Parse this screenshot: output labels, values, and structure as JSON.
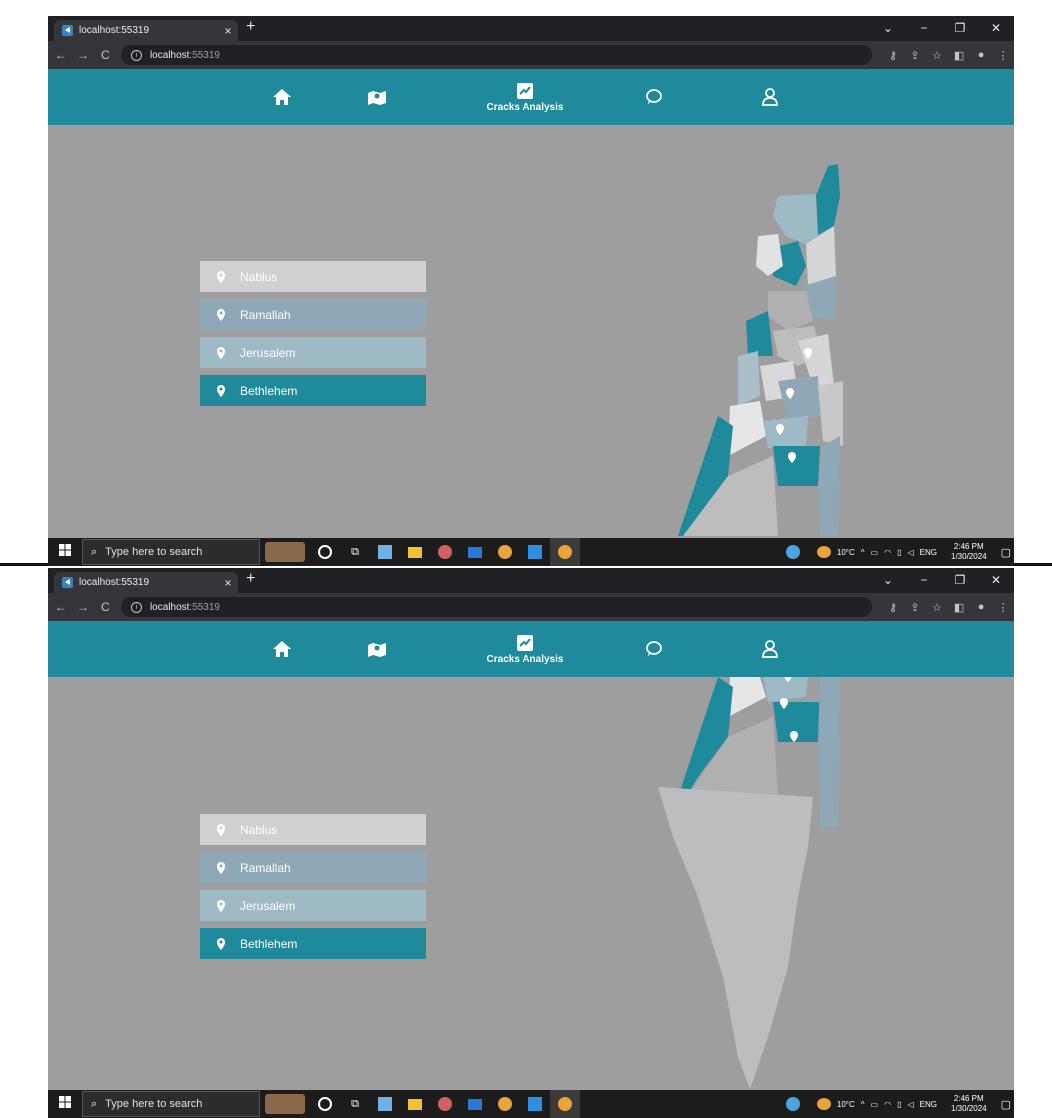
{
  "browser": {
    "tab_title": "localhost:55319",
    "tab_close": "×",
    "new_tab": "+",
    "url_host": "localhost",
    "url_port": ":55319",
    "window_controls": [
      "⌄",
      "−",
      "❐",
      "✕"
    ],
    "nav_icons": [
      "back-arrow-icon",
      "forward-arrow-icon",
      "reload-icon"
    ]
  },
  "app": {
    "header_color": "#1f8a9c",
    "nav": [
      {
        "icon": "home-icon"
      },
      {
        "icon": "map-icon"
      },
      {
        "icon": "cracks-analysis-icon",
        "label": "Cracks Analysis"
      },
      {
        "icon": "chat-icon"
      },
      {
        "icon": "user-icon"
      }
    ]
  },
  "regions": [
    {
      "name": "Nablus",
      "color": "#d0d0d0"
    },
    {
      "name": "Ramallah",
      "color": "#8fa8b7"
    },
    {
      "name": "Jerusalem",
      "color": "#9ebbc5"
    },
    {
      "name": "Bethlehem",
      "color": "#1f8a9c"
    }
  ],
  "taskbar": {
    "search_placeholder": "Type here to search",
    "weather": "10°C",
    "lang": "ENG",
    "time": "2:46 PM",
    "date": "1/30/2024"
  }
}
